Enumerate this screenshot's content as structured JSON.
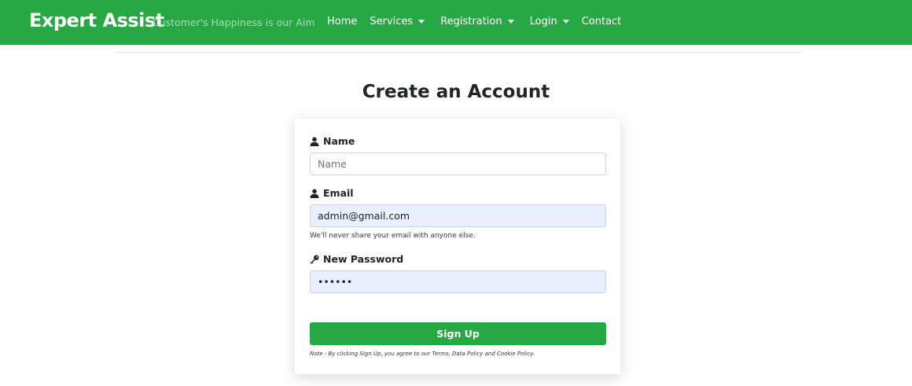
{
  "brand": {
    "title": "Expert Assist",
    "tagline": "Customer's Happiness is our Aim"
  },
  "nav": {
    "items": [
      {
        "label": "Home",
        "dropdown": false
      },
      {
        "label": "Services",
        "dropdown": true
      },
      {
        "label": "Registration",
        "dropdown": true
      },
      {
        "label": "Login",
        "dropdown": true
      },
      {
        "label": "Contact",
        "dropdown": false
      }
    ]
  },
  "form": {
    "title": "Create an Account",
    "name": {
      "label": "Name",
      "placeholder": "Name",
      "value": "",
      "icon": "user-icon"
    },
    "email": {
      "label": "Email",
      "value": "admin@gmail.com",
      "icon": "user-icon",
      "help": "We'll never share your email with anyone else."
    },
    "password": {
      "label": "New Password",
      "value": "••••••",
      "icon": "key-icon"
    },
    "submit_label": "Sign Up",
    "note": "Note - By clicking Sign Up, you agree to our Terms, Data Policy and Cookie Policy."
  },
  "colors": {
    "primary": "#28a745",
    "autofill": "#e8f0fe"
  }
}
